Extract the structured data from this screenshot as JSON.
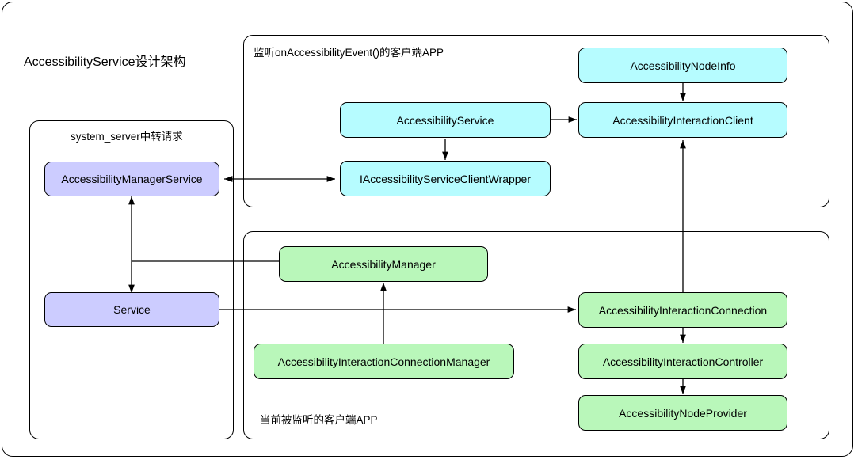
{
  "diagram": {
    "title": "AccessibilityService设计架构",
    "colors": {
      "purple": "#ccccff",
      "cyan": "#b6fcff",
      "green": "#b9f7ba",
      "stroke": "#000000",
      "background": "#ffffff"
    }
  },
  "groups": {
    "system_server": {
      "label": "system_server中转请求"
    },
    "listener_app": {
      "label": "监听onAccessibilityEvent()的客户端APP"
    },
    "listened_app": {
      "label": "当前被监听的客户端APP"
    }
  },
  "nodes": {
    "accessibility_manager_service": "AccessibilityManagerService",
    "service": "Service",
    "accessibility_service": "AccessibilityService",
    "iaccessibility_service_client_wrapper": "IAccessibilityServiceClientWrapper",
    "accessibility_node_info": "AccessibilityNodeInfo",
    "accessibility_interaction_client": "AccessibilityInteractionClient",
    "accessibility_manager": "AccessibilityManager",
    "accessibility_interaction_connection_manager": "AccessibilityInteractionConnectionManager",
    "accessibility_interaction_connection": "AccessibilityInteractionConnection",
    "accessibility_interaction_controller": "AccessibilityInteractionController",
    "accessibility_node_provider": "AccessibilityNodeProvider"
  }
}
